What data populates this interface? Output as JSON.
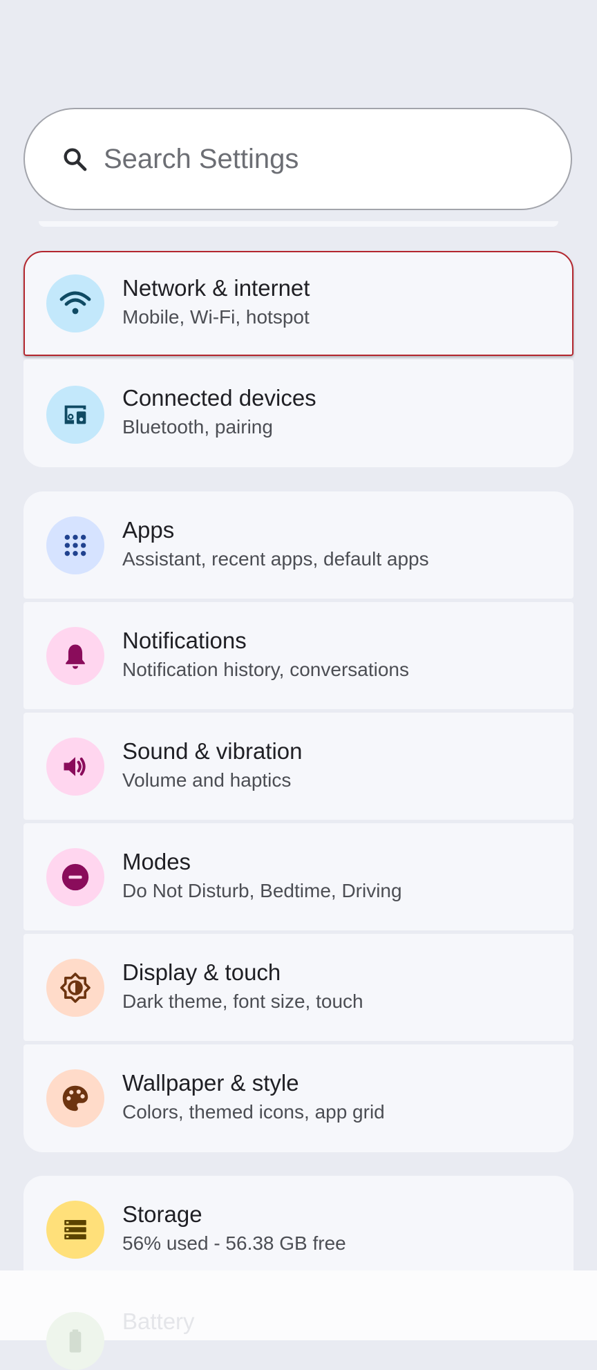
{
  "search": {
    "placeholder": "Search Settings"
  },
  "items": [
    {
      "title": "Network & internet",
      "subtitle": "Mobile, Wi-Fi, hotspot",
      "icon": "wifi-icon",
      "icon_bg": "#c3e8fb",
      "icon_color": "#0f4a63",
      "selected": true
    },
    {
      "title": "Connected devices",
      "subtitle": "Bluetooth, pairing",
      "icon": "connected-devices-icon",
      "icon_bg": "#c3e8fb",
      "icon_color": "#0f4a63"
    },
    {
      "title": "Apps",
      "subtitle": "Assistant, recent apps, default apps",
      "icon": "apps-grid-icon",
      "icon_bg": "#d6e3ff",
      "icon_color": "#20428f"
    },
    {
      "title": "Notifications",
      "subtitle": "Notification history, conversations",
      "icon": "bell-icon",
      "icon_bg": "#ffd6ef",
      "icon_color": "#8a0c5b"
    },
    {
      "title": "Sound & vibration",
      "subtitle": "Volume and haptics",
      "icon": "speaker-icon",
      "icon_bg": "#ffd6ef",
      "icon_color": "#8a0c5b"
    },
    {
      "title": "Modes",
      "subtitle": "Do Not Disturb, Bedtime, Driving",
      "icon": "do-not-disturb-icon",
      "icon_bg": "#ffd6ef",
      "icon_color": "#8a0c5b"
    },
    {
      "title": "Display & touch",
      "subtitle": "Dark theme, font size, touch",
      "icon": "brightness-icon",
      "icon_bg": "#ffdbc9",
      "icon_color": "#6d3410"
    },
    {
      "title": "Wallpaper & style",
      "subtitle": "Colors, themed icons, app grid",
      "icon": "palette-icon",
      "icon_bg": "#ffdbc9",
      "icon_color": "#6d3410"
    },
    {
      "title": "Storage",
      "subtitle": "56% used - 56.38 GB free",
      "icon": "storage-icon",
      "icon_bg": "#ffe07a",
      "icon_color": "#5b4300"
    },
    {
      "title": "Battery",
      "icon": "battery-icon",
      "icon_bg": "#e6f2e4",
      "icon_color": "#cfd8cd"
    }
  ]
}
